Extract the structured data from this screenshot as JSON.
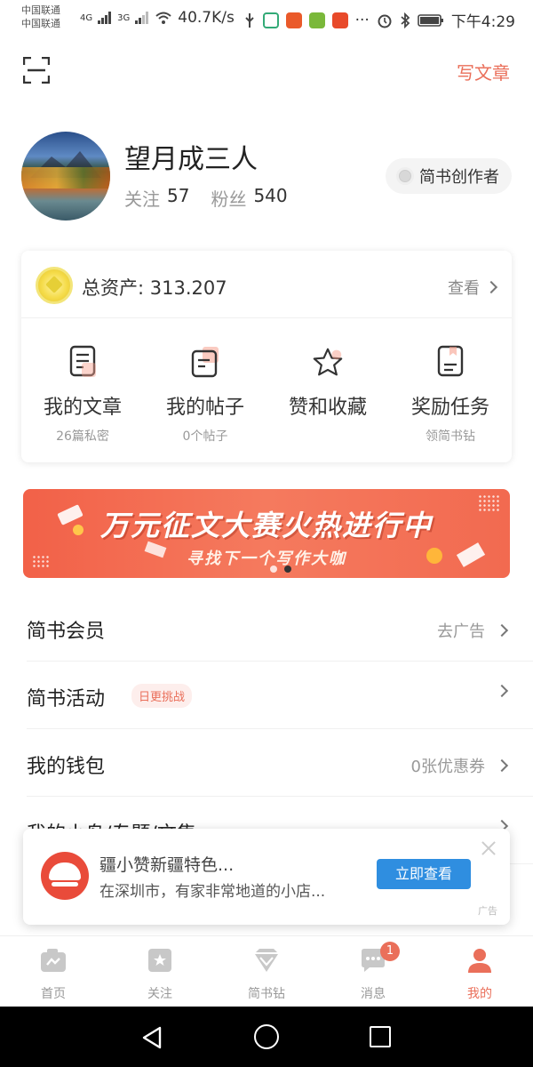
{
  "status_bar": {
    "carrier1": "中国联通",
    "carrier2": "中国联通",
    "net1": "4G",
    "net2": "3G",
    "speed": "40.7K/s",
    "more": "···",
    "time": "下午4:29"
  },
  "header": {
    "write_label": "写文章"
  },
  "profile": {
    "nickname": "望月成三人",
    "following_label": "关注",
    "following_count": "57",
    "followers_label": "粉丝",
    "followers_count": "540",
    "badge_label": "简书创作者"
  },
  "assets": {
    "label": "总资产: 313.207",
    "view_label": "查看"
  },
  "grid": [
    {
      "title": "我的文章",
      "sub": "26篇私密"
    },
    {
      "title": "我的帖子",
      "sub": "0个帖子"
    },
    {
      "title": "赞和收藏",
      "sub": ""
    },
    {
      "title": "奖励任务",
      "sub": "领简书钻"
    }
  ],
  "banner": {
    "line1": "万元征文大赛火热进行中",
    "line2": "寻找下一个写作大咖",
    "page_count": 2,
    "active_page": 1
  },
  "list": [
    {
      "title": "简书会员",
      "right": "去广告",
      "tag": ""
    },
    {
      "title": "简书活动",
      "right": "",
      "tag": "日更挑战"
    },
    {
      "title": "我的钱包",
      "right": "0张优惠券",
      "tag": ""
    },
    {
      "title": "我的小岛/专题/文集",
      "right": "",
      "tag": ""
    }
  ],
  "ad": {
    "title": "疆小赞新疆特色...",
    "desc": "在深圳市，有家非常地道的小店...",
    "button": "立即查看",
    "mark": "广告"
  },
  "tabs": [
    {
      "label": "首页",
      "active": false
    },
    {
      "label": "关注",
      "active": false
    },
    {
      "label": "简书钻",
      "active": false
    },
    {
      "label": "消息",
      "active": false,
      "badge": "1"
    },
    {
      "label": "我的",
      "active": true
    }
  ],
  "colors": {
    "accent": "#ea6f5a",
    "ad_button": "#2f8ee0",
    "banner": "#f26148"
  }
}
